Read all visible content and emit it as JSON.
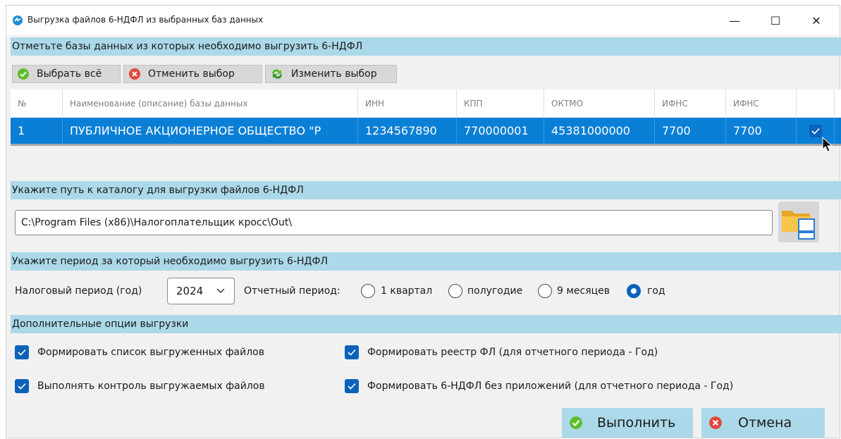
{
  "window": {
    "title": "Выгрузка файлов 6-НДФЛ из выбранных баз данных",
    "controls": {
      "minimize": "—",
      "maximize": "☐",
      "close": "✕"
    }
  },
  "databases_section": {
    "header": "Отметьте базы данных из которых необходимо выгрузить 6-НДФЛ",
    "toolbar": {
      "select_all": "Выбрать всё",
      "deselect": "Отменить выбор",
      "invert": "Изменить выбор"
    },
    "columns": [
      "№",
      "Наименование (описание) базы данных",
      "ИНН",
      "КПП",
      "ОКТМО",
      "ИФНС",
      "ИФНС",
      ""
    ],
    "rows": [
      {
        "num": "1",
        "name": "ПУБЛИЧНОЕ АКЦИОНЕРНОЕ ОБЩЕСТВО \"Р",
        "inn": "1234567890",
        "kpp": "770000001",
        "oktmo": "45381000000",
        "ifns1": "7700",
        "ifns2": "7700",
        "checked": true
      }
    ]
  },
  "path_section": {
    "header": "Укажите путь к каталогу для выгрузки файлов 6-НДФЛ",
    "path_value": "C:\\Program Files (x86)\\Налогоплательщик кросс\\Out\\"
  },
  "period_section": {
    "header": "Укажите период за который необходимо выгрузить 6-НДФЛ",
    "tax_period_label": "Налоговый период (год)",
    "tax_year": "2024",
    "report_period_label": "Отчетный период:",
    "options": [
      {
        "label": "1 квартал",
        "selected": false
      },
      {
        "label": "полугодие",
        "selected": false
      },
      {
        "label": "9 месяцев",
        "selected": false
      },
      {
        "label": "год",
        "selected": true
      }
    ]
  },
  "options_section": {
    "header": "Дополнительные опции выгрузки",
    "options": [
      {
        "label": "Формировать список выгруженных файлов",
        "checked": true
      },
      {
        "label": "Формировать реестр ФЛ (для отчетного периода - Год)",
        "checked": true
      },
      {
        "label": "Выполнять контроль выгружаемых файлов",
        "checked": true
      },
      {
        "label": "Формировать 6-НДФЛ без приложений (для отчетного периода - Год)",
        "checked": true
      }
    ]
  },
  "actions": {
    "run": "Выполнить",
    "cancel": "Отмена"
  },
  "colors": {
    "band": "#acd9e9",
    "selection": "#0a7fd6",
    "accent": "#0b62b8",
    "ok_green": "#5cbf2a",
    "cancel_red": "#e2463d"
  },
  "icons": [
    "app-icon",
    "check-circle-icon",
    "cancel-circle-icon",
    "refresh-arrows-icon",
    "folder-browse-icon",
    "chevron-down-icon",
    "mouse-cursor-icon"
  ]
}
